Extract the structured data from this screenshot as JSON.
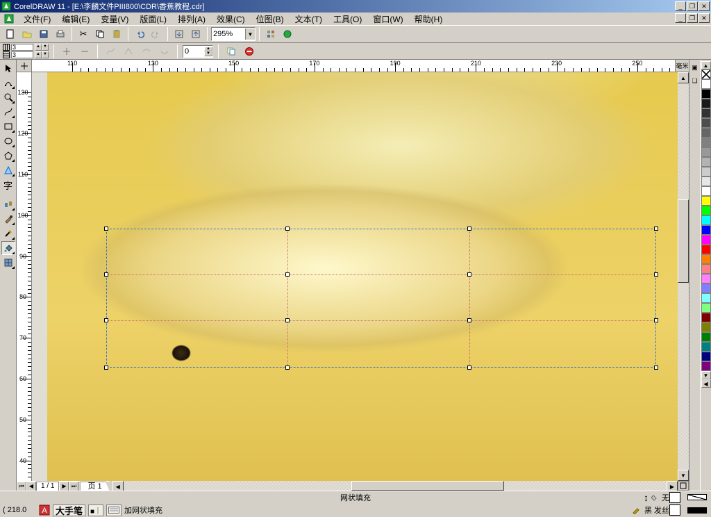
{
  "title": "CorelDRAW 11 - [E:\\李麟文件PIII800\\CDR\\香蕉教程.cdr]",
  "menus": [
    "文件(F)",
    "编辑(E)",
    "变量(V)",
    "版面(L)",
    "排列(A)",
    "效果(C)",
    "位图(B)",
    "文本(T)",
    "工具(O)",
    "窗口(W)",
    "帮助(H)"
  ],
  "zoom": "295%",
  "grid_cols": "3",
  "grid_rows": "3",
  "prop_value": "0",
  "ruler_unit": "毫米",
  "ruler_h": [
    110,
    130,
    150,
    170,
    190,
    210,
    230,
    250
  ],
  "ruler_v": [
    130,
    120,
    110,
    100,
    90,
    80,
    70,
    60,
    50,
    40
  ],
  "page_count": "1 / 1",
  "page_tab": "页 1",
  "colors": [
    "#FFFFFF",
    "#000000",
    "#1a1a1a",
    "#333333",
    "#4d4d4d",
    "#666666",
    "#808080",
    "#999999",
    "#b3b3b3",
    "#cccccc",
    "#e6e6e6",
    "#FFFFFF",
    "#ffff00",
    "#00ff00",
    "#00ffff",
    "#0000ff",
    "#ff00ff",
    "#ff0000",
    "#ff8000",
    "#ff8080",
    "#ff80ff",
    "#8080ff",
    "#80ffff",
    "#80ff80",
    "#800000",
    "#808000",
    "#008000",
    "#008080",
    "#000080",
    "#800080"
  ],
  "status": {
    "tool": "网状填充",
    "fill": "无",
    "outline": "黑 发丝",
    "coord": "( 218.0",
    "ime1": "大手笔",
    "ime2": "加网状填充"
  }
}
